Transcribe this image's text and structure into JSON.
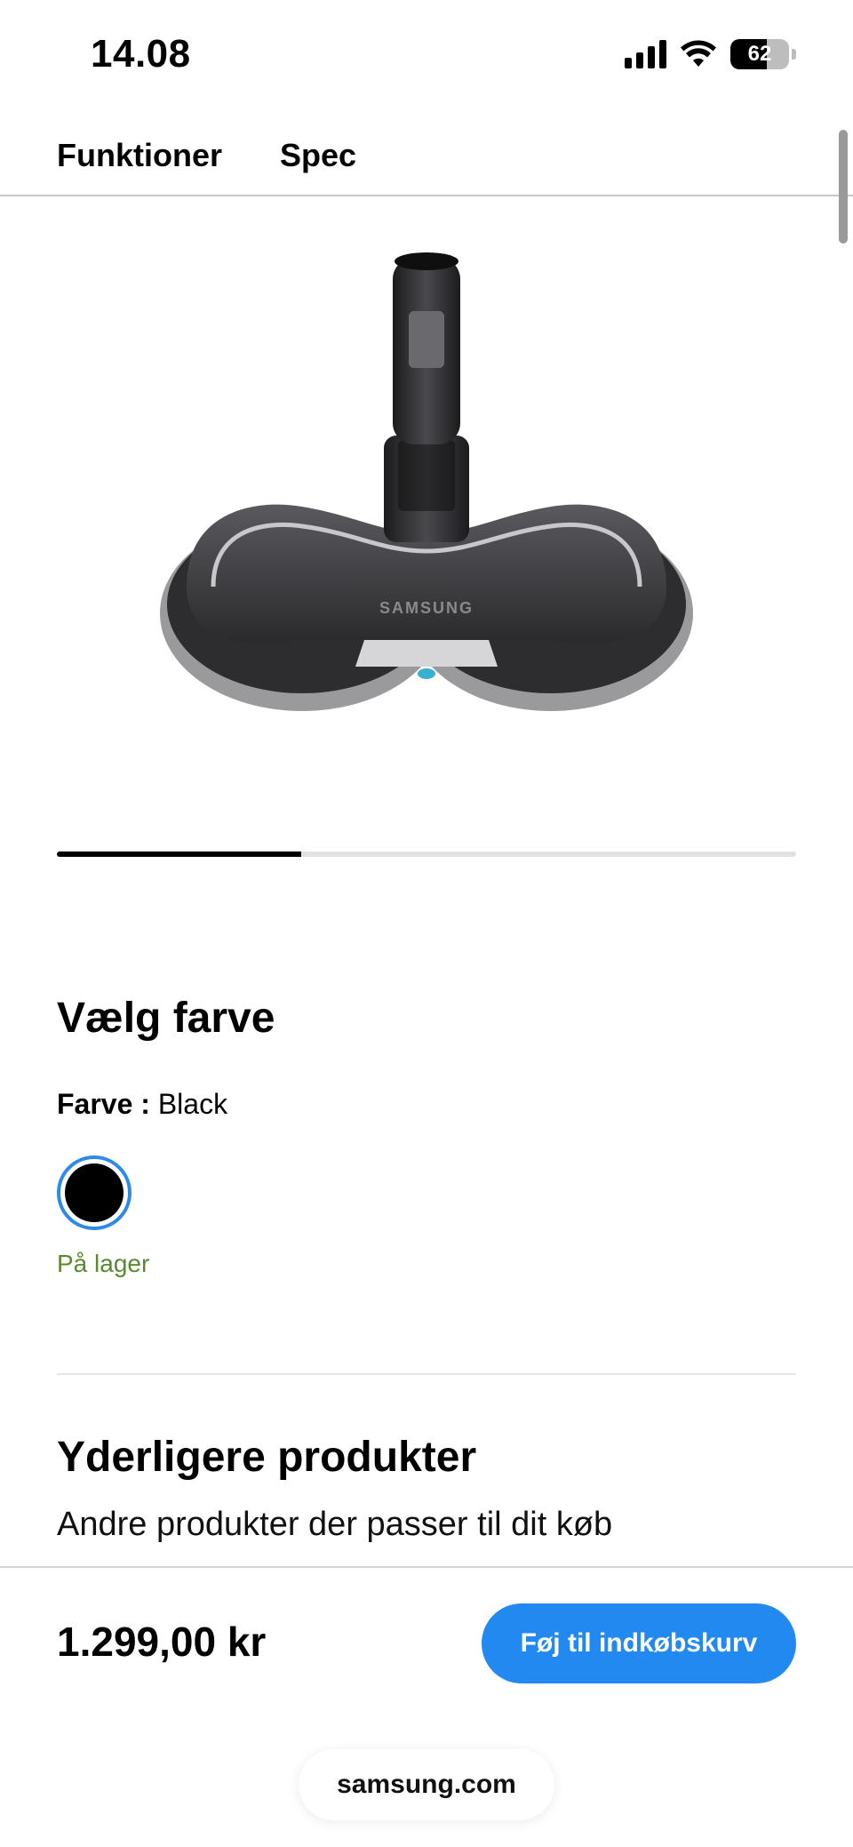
{
  "status_bar": {
    "time": "14.08",
    "battery_level": "62",
    "battery_fraction": 0.62,
    "icons": [
      "cellular-signal-icon",
      "wifi-icon",
      "battery-icon"
    ]
  },
  "tabs": [
    {
      "label": "Funktioner"
    },
    {
      "label": "Spec"
    }
  ],
  "product": {
    "image_icon": "spin-mop-head-image",
    "image_brand_text": "SAMSUNG",
    "gallery_progress_fraction": 0.33
  },
  "color_section": {
    "heading": "Vælg farve",
    "color_label": "Farve :",
    "color_value": "Black",
    "swatch_color": "#000000",
    "selected_ring_color": "#2D8AE8",
    "stock_status": "På lager",
    "stock_color": "#5A8A2E"
  },
  "additional": {
    "heading": "Yderligere produkter",
    "subtitle": "Andre produkter der passer til dit køb"
  },
  "purchase": {
    "price": "1.299,00 kr",
    "button_label": "Føj til indkøbskurv",
    "button_color": "#2189F0"
  },
  "browser": {
    "url": "samsung.com"
  }
}
